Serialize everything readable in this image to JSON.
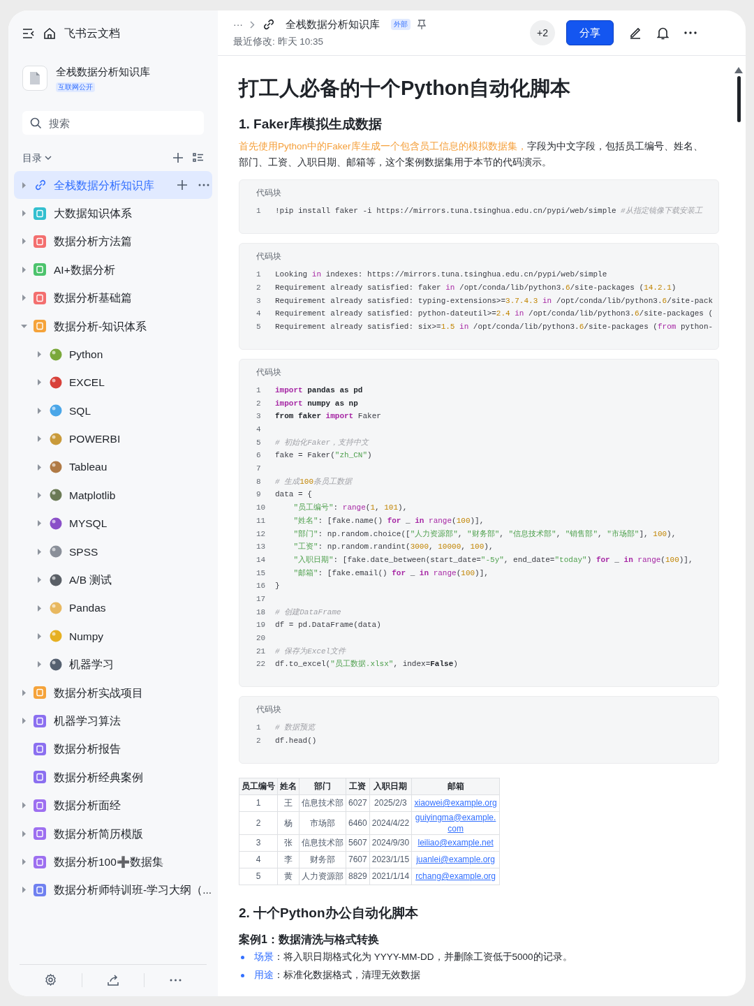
{
  "sidebar": {
    "app_title": "飞书云文档",
    "space": {
      "title": "全栈数据分析知识库",
      "badge": "互联网公开"
    },
    "search": {
      "placeholder": "搜索"
    },
    "toc_label": "目录",
    "tree": [
      {
        "label": "全栈数据分析知识库",
        "kind": "root",
        "selected": true,
        "expanded": false
      },
      {
        "label": "大数据知识体系",
        "kind": "group",
        "selected": false,
        "expanded": false,
        "color": "#33bfcf"
      },
      {
        "label": "数据分析方法篇",
        "kind": "group",
        "selected": false,
        "expanded": false,
        "color": "#f36f6f"
      },
      {
        "label": "AI+数据分析",
        "kind": "group",
        "selected": false,
        "expanded": false,
        "color": "#4cc36c"
      },
      {
        "label": "数据分析基础篇",
        "kind": "group",
        "selected": false,
        "expanded": false,
        "color": "#f36f6f"
      },
      {
        "label": "数据分析-知识体系",
        "kind": "group",
        "selected": false,
        "expanded": true,
        "color": "#f5a33a",
        "children": [
          {
            "label": "Python",
            "kind": "group",
            "selected": false,
            "expanded": false,
            "color": "#7aa83a"
          },
          {
            "label": "EXCEL",
            "kind": "group",
            "selected": false,
            "expanded": false,
            "color": "#d8413a"
          },
          {
            "label": "SQL",
            "kind": "group",
            "selected": false,
            "expanded": false,
            "color": "#4aa6e8"
          },
          {
            "label": "POWERBI",
            "kind": "group",
            "selected": false,
            "expanded": false,
            "color": "#c99a3a"
          },
          {
            "label": "Tableau",
            "kind": "group",
            "selected": false,
            "expanded": false,
            "color": "#b07a45"
          },
          {
            "label": "Matplotlib",
            "kind": "group",
            "selected": false,
            "expanded": false,
            "color": "#6b7a55"
          },
          {
            "label": "MYSQL",
            "kind": "group",
            "selected": false,
            "expanded": false,
            "color": "#8a4fc8"
          },
          {
            "label": "SPSS",
            "kind": "group",
            "selected": false,
            "expanded": false,
            "color": "#8a8f99"
          },
          {
            "label": "A/B 测试",
            "kind": "group",
            "selected": false,
            "expanded": false,
            "color": "#5a5f66"
          },
          {
            "label": "Pandas",
            "kind": "group",
            "selected": false,
            "expanded": false,
            "color": "#e8b860"
          },
          {
            "label": "Numpy",
            "kind": "group",
            "selected": false,
            "expanded": false,
            "color": "#e6b022"
          },
          {
            "label": "机器学习",
            "kind": "group",
            "selected": false,
            "expanded": false,
            "color": "#556070"
          }
        ]
      },
      {
        "label": "数据分析实战项目",
        "kind": "group",
        "selected": false,
        "expanded": false,
        "color": "#f5a33a"
      },
      {
        "label": "机器学习算法",
        "kind": "group",
        "selected": false,
        "expanded": false,
        "color": "#8b6ff0"
      },
      {
        "label": "数据分析报告",
        "kind": "page",
        "selected": false,
        "color": "#8b6ff0"
      },
      {
        "label": "数据分析经典案例",
        "kind": "page",
        "selected": false,
        "color": "#8b6ff0"
      },
      {
        "label": "数据分析面经",
        "kind": "group",
        "selected": false,
        "expanded": false,
        "color": "#9d6ff0"
      },
      {
        "label": "数据分析简历模版",
        "kind": "group",
        "selected": false,
        "expanded": false,
        "color": "#9d6ff0"
      },
      {
        "label": "数据分析100➕数据集",
        "kind": "group",
        "selected": false,
        "expanded": false,
        "color": "#9d6ff0"
      },
      {
        "label": "数据分析师特训班-学习大纲（...",
        "kind": "group",
        "selected": false,
        "expanded": false,
        "color": "#6f80f0"
      }
    ]
  },
  "header": {
    "ellipsis": "···",
    "breadcrumb": "全栈数据分析知识库",
    "badge": "外部",
    "modified": "最近修改: 昨天 10:35",
    "collaborators": "+2",
    "share": "分享"
  },
  "document": {
    "title": "打工人必备的十个Python自动化脚本",
    "section1": {
      "heading": "1. Faker库模拟生成数据",
      "intro": [
        {
          "kind": "highlight",
          "text": "首先使用Python中的Faker库生成一个包含员工信息的模拟数据集，"
        },
        {
          "kind": "plain",
          "text": "字段为中文字段，包括员工编号、姓名、部门、工资、入职日期、邮箱等，这个案例数据集用于本节的代码演示。"
        }
      ]
    },
    "code_blocks": [
      {
        "label": "代码块",
        "lines": [
          {
            "n": "1",
            "t": [
              {
                "kind": "p",
                "text": "!pip install faker -i https://mirrors.tuna.tsinghua.edu.cn/pypi/web/simple"
              },
              {
                "kind": "cm",
                "text": " #从指定镜像下载安装工"
              }
            ]
          }
        ]
      },
      {
        "label": "代码块",
        "lines": [
          {
            "n": "1",
            "t": [
              {
                "kind": "p",
                "text": "Looking"
              },
              {
                "kind": "fn",
                "text": " in"
              },
              {
                "kind": "p",
                "text": " indexes: https://mirrors.tuna.tsinghua.edu.cn/pypi/web/simple"
              }
            ]
          },
          {
            "n": "2",
            "t": [
              {
                "kind": "p",
                "text": "Requirement already satisfied: faker"
              },
              {
                "kind": "fn",
                "text": " in"
              },
              {
                "kind": "p",
                "text": " /opt/conda/lib/python3."
              },
              {
                "kind": "num",
                "text": "6"
              },
              {
                "kind": "p",
                "text": "/site-packages ("
              },
              {
                "kind": "num",
                "text": "14.2.1"
              },
              {
                "kind": "p",
                "text": ")"
              }
            ]
          },
          {
            "n": "3",
            "t": [
              {
                "kind": "p",
                "text": "Requirement already satisfied: typing-extensions>="
              },
              {
                "kind": "num",
                "text": "3.7.4.3"
              },
              {
                "kind": "fn",
                "text": " in"
              },
              {
                "kind": "p",
                "text": " /opt/conda/lib/python3."
              },
              {
                "kind": "num",
                "text": "6"
              },
              {
                "kind": "p",
                "text": "/site-pack"
              }
            ]
          },
          {
            "n": "4",
            "t": [
              {
                "kind": "p",
                "text": "Requirement already satisfied: python-dateutil>="
              },
              {
                "kind": "num",
                "text": "2.4"
              },
              {
                "kind": "fn",
                "text": " in"
              },
              {
                "kind": "p",
                "text": " /opt/conda/lib/python3."
              },
              {
                "kind": "num",
                "text": "6"
              },
              {
                "kind": "p",
                "text": "/site-packages ("
              }
            ]
          },
          {
            "n": "5",
            "t": [
              {
                "kind": "p",
                "text": "Requirement already satisfied: six>="
              },
              {
                "kind": "num",
                "text": "1.5"
              },
              {
                "kind": "fn",
                "text": " in"
              },
              {
                "kind": "p",
                "text": " /opt/conda/lib/python3."
              },
              {
                "kind": "num",
                "text": "6"
              },
              {
                "kind": "p",
                "text": "/site-packages ("
              },
              {
                "kind": "fn",
                "text": "from"
              },
              {
                "kind": "p",
                "text": " python-"
              }
            ]
          }
        ]
      },
      {
        "label": "代码块",
        "lines": [
          {
            "n": "1",
            "t": [
              {
                "kind": "kw",
                "text": "import"
              },
              {
                "kind": "b",
                "text": " pandas as pd"
              }
            ]
          },
          {
            "n": "2",
            "t": [
              {
                "kind": "kw",
                "text": "import"
              },
              {
                "kind": "b",
                "text": " numpy as np"
              }
            ]
          },
          {
            "n": "3",
            "t": [
              {
                "kind": "b",
                "text": "from faker"
              },
              {
                "kind": "kw",
                "text": " import"
              },
              {
                "kind": "p",
                "text": " Faker"
              }
            ]
          },
          {
            "n": "4"
          },
          {
            "n": "5",
            "t": [
              {
                "kind": "cm",
                "text": "# 初始化Faker，支持中文"
              }
            ]
          },
          {
            "n": "6",
            "t": [
              {
                "kind": "p",
                "text": "fake = Faker("
              },
              {
                "kind": "str",
                "text": "\"zh_CN\""
              },
              {
                "kind": "p",
                "text": ")"
              }
            ]
          },
          {
            "n": "7"
          },
          {
            "n": "8",
            "t": [
              {
                "kind": "cm",
                "text": "# 生成"
              },
              {
                "kind": "num",
                "text": "100"
              },
              {
                "kind": "cm",
                "text": "条员工数据"
              }
            ]
          },
          {
            "n": "9",
            "t": [
              {
                "kind": "p",
                "text": "data = {"
              }
            ]
          },
          {
            "n": "10",
            "t": [
              {
                "kind": "str",
                "text": "    \"员工编号\""
              },
              {
                "kind": "p",
                "text": ": "
              },
              {
                "kind": "fn",
                "text": "range"
              },
              {
                "kind": "p",
                "text": "("
              },
              {
                "kind": "num",
                "text": "1"
              },
              {
                "kind": "p",
                "text": ", "
              },
              {
                "kind": "num",
                "text": "101"
              },
              {
                "kind": "p",
                "text": "),"
              }
            ]
          },
          {
            "n": "11",
            "t": [
              {
                "kind": "str",
                "text": "    \"姓名\""
              },
              {
                "kind": "p",
                "text": ": [fake.name() "
              },
              {
                "kind": "kw",
                "text": "for"
              },
              {
                "kind": "p",
                "text": " _ "
              },
              {
                "kind": "kw",
                "text": "in"
              },
              {
                "kind": "fn",
                "text": " range"
              },
              {
                "kind": "p",
                "text": "("
              },
              {
                "kind": "num",
                "text": "100"
              },
              {
                "kind": "p",
                "text": ")],"
              }
            ]
          },
          {
            "n": "12",
            "t": [
              {
                "kind": "str",
                "text": "    \"部门\""
              },
              {
                "kind": "p",
                "text": ": np.random.choice(["
              },
              {
                "kind": "str",
                "text": "\"人力资源部\""
              },
              {
                "kind": "p",
                "text": ", "
              },
              {
                "kind": "str",
                "text": "\"财务部\""
              },
              {
                "kind": "p",
                "text": ", "
              },
              {
                "kind": "str",
                "text": "\"信息技术部\""
              },
              {
                "kind": "p",
                "text": ", "
              },
              {
                "kind": "str",
                "text": "\"销售部\""
              },
              {
                "kind": "p",
                "text": ", "
              },
              {
                "kind": "str",
                "text": "\"市场部\""
              },
              {
                "kind": "p",
                "text": "], "
              },
              {
                "kind": "num",
                "text": "100"
              },
              {
                "kind": "p",
                "text": "),"
              }
            ]
          },
          {
            "n": "13",
            "t": [
              {
                "kind": "str",
                "text": "    \"工资\""
              },
              {
                "kind": "p",
                "text": ": np.random.randint("
              },
              {
                "kind": "num",
                "text": "3000"
              },
              {
                "kind": "p",
                "text": ", "
              },
              {
                "kind": "num",
                "text": "10000"
              },
              {
                "kind": "p",
                "text": ", "
              },
              {
                "kind": "num",
                "text": "100"
              },
              {
                "kind": "p",
                "text": "),"
              }
            ]
          },
          {
            "n": "14",
            "t": [
              {
                "kind": "str",
                "text": "    \"入职日期\""
              },
              {
                "kind": "p",
                "text": ": [fake.date_between(start_date="
              },
              {
                "kind": "str",
                "text": "\"-5y\""
              },
              {
                "kind": "p",
                "text": ", end_date="
              },
              {
                "kind": "str",
                "text": "\"today\""
              },
              {
                "kind": "p",
                "text": ") "
              },
              {
                "kind": "kw",
                "text": "for"
              },
              {
                "kind": "p",
                "text": " _ "
              },
              {
                "kind": "kw",
                "text": "in"
              },
              {
                "kind": "fn",
                "text": " range"
              },
              {
                "kind": "p",
                "text": "("
              },
              {
                "kind": "num",
                "text": "100"
              },
              {
                "kind": "p",
                "text": ")],"
              }
            ]
          },
          {
            "n": "15",
            "t": [
              {
                "kind": "str",
                "text": "    \"邮箱\""
              },
              {
                "kind": "p",
                "text": ": [fake.email() "
              },
              {
                "kind": "kw",
                "text": "for"
              },
              {
                "kind": "p",
                "text": " _ "
              },
              {
                "kind": "kw",
                "text": "in"
              },
              {
                "kind": "fn",
                "text": " range"
              },
              {
                "kind": "p",
                "text": "("
              },
              {
                "kind": "num",
                "text": "100"
              },
              {
                "kind": "p",
                "text": ")],"
              }
            ]
          },
          {
            "n": "16",
            "t": [
              {
                "kind": "p",
                "text": "}"
              }
            ]
          },
          {
            "n": "17"
          },
          {
            "n": "18",
            "t": [
              {
                "kind": "cm",
                "text": "# 创建DataFrame"
              }
            ]
          },
          {
            "n": "19",
            "t": [
              {
                "kind": "p",
                "text": "df = pd.DataFrame(data)"
              }
            ]
          },
          {
            "n": "20"
          },
          {
            "n": "21",
            "t": [
              {
                "kind": "cm",
                "text": "# 保存为Excel文件"
              }
            ]
          },
          {
            "n": "22",
            "t": [
              {
                "kind": "p",
                "text": "df.to_excel("
              },
              {
                "kind": "str",
                "text": "\"员工数据.xlsx\""
              },
              {
                "kind": "p",
                "text": ", index="
              },
              {
                "kind": "b",
                "text": "False"
              },
              {
                "kind": "p",
                "text": ")"
              }
            ]
          }
        ]
      },
      {
        "label": "代码块",
        "lines": [
          {
            "n": "1",
            "t": [
              {
                "kind": "cm",
                "text": "# 数据预览"
              }
            ]
          },
          {
            "n": "2",
            "t": [
              {
                "kind": "p",
                "text": "df.head()"
              }
            ]
          }
        ]
      }
    ],
    "table": {
      "columns": [
        "员工编号",
        "姓名",
        "部门",
        "工资",
        "入职日期",
        "邮箱"
      ],
      "rows": [
        [
          "1",
          "王",
          "信息技术部",
          "6027",
          "2025/2/3",
          "xiaowei@example.org"
        ],
        [
          "2",
          "杨",
          "市场部",
          "6460",
          "2024/4/22",
          "guiyingma@example.com"
        ],
        [
          "3",
          "张",
          "信息技术部",
          "5607",
          "2024/9/30",
          "leiliao@example.net"
        ],
        [
          "4",
          "李",
          "财务部",
          "7607",
          "2023/1/15",
          "juanlei@example.org"
        ],
        [
          "5",
          "黄",
          "人力资源部",
          "8829",
          "2021/1/14",
          "rchang@example.org"
        ]
      ]
    },
    "section2": {
      "heading": "2. 十个Python办公自动化脚本",
      "case_title": "案例1：数据清洗与格式转换",
      "bullets": [
        {
          "label": "场景",
          "text": "：将入职日期格式化为 YYYY-MM-DD，并删除工资低于5000的记录。"
        },
        {
          "label": "用途",
          "text": "：标准化数据格式，清理无效数据"
        }
      ]
    }
  }
}
